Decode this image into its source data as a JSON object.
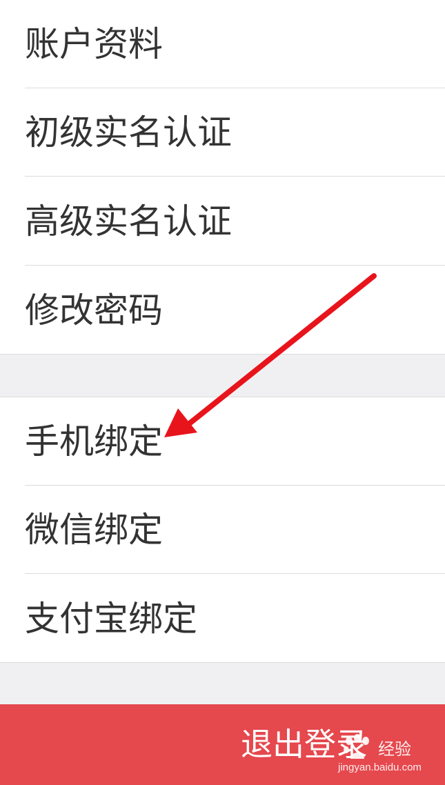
{
  "settings": {
    "group1": [
      {
        "label": "账户资料"
      },
      {
        "label": "初级实名认证"
      },
      {
        "label": "高级实名认证"
      },
      {
        "label": "修改密码"
      }
    ],
    "group2": [
      {
        "label": "手机绑定"
      },
      {
        "label": "微信绑定"
      },
      {
        "label": "支付宝绑定"
      }
    ]
  },
  "logout": {
    "label": "退出登录"
  },
  "watermark": {
    "brand": "经验",
    "url": "jingyan.baidu.com"
  },
  "annotation": {
    "arrow_color": "#e8141c",
    "arrow_icon": "red-arrow-icon",
    "points_to": "手机绑定"
  },
  "colors": {
    "logout_background": "#e5484d",
    "page_background": "#f0f0f2",
    "text": "#333333"
  }
}
